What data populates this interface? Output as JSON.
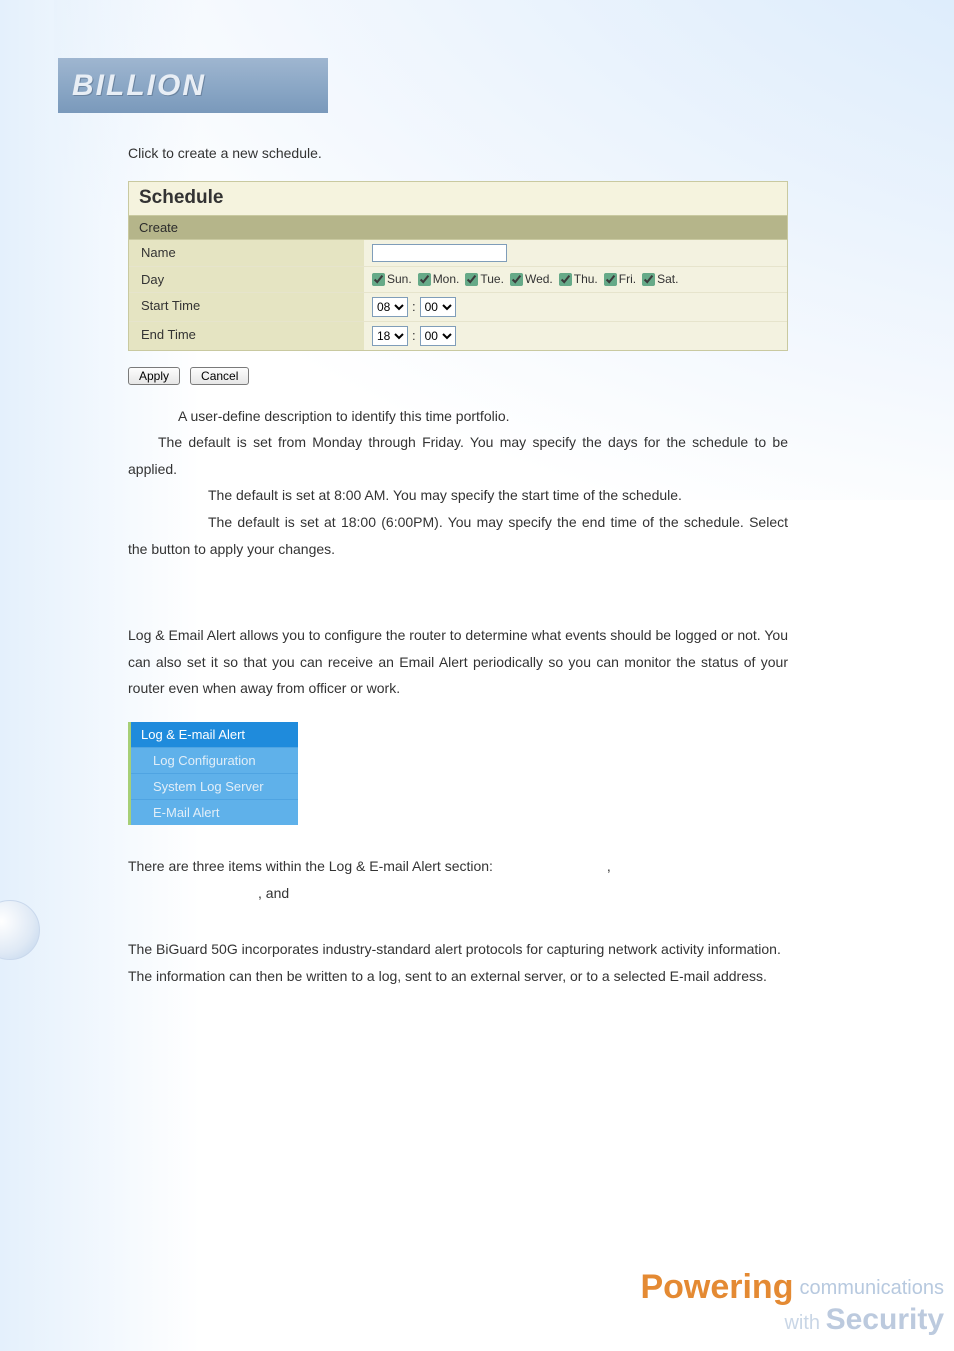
{
  "header": {
    "logo_text": "BILLION"
  },
  "intro": {
    "click_prefix": "Click ",
    "click_suffix": " to create a new schedule."
  },
  "schedule": {
    "title": "Schedule",
    "subtitle": "Create",
    "name_label": "Name",
    "name_value": "",
    "day_label": "Day",
    "days": [
      {
        "label": "Sun.",
        "checked": true
      },
      {
        "label": "Mon.",
        "checked": true
      },
      {
        "label": "Tue.",
        "checked": true
      },
      {
        "label": "Wed.",
        "checked": true
      },
      {
        "label": "Thu.",
        "checked": true
      },
      {
        "label": "Fri.",
        "checked": true
      },
      {
        "label": "Sat.",
        "checked": true
      }
    ],
    "start_label": "Start Time",
    "start_hour": "08",
    "start_min": "00",
    "end_label": "End Time",
    "end_hour": "18",
    "end_min": "00",
    "apply_btn": "Apply",
    "cancel_btn": "Cancel"
  },
  "definitions": {
    "name_text": "A user-define description to identify this time portfolio.",
    "day_text": "The default is set from Monday through Friday.   You may specify the days for the schedule to be applied.",
    "start_text": "The default is set at 8:00 AM.   You may specify the start time of the schedule.",
    "end_pre": "The default is set at 18:00 (6:00PM). You may specify the end time of the schedule. Select the ",
    "end_post": " button to apply your changes."
  },
  "logalert": {
    "paragraph": "Log & Email Alert allows you to configure the router to determine what events should be logged or not. You can also set it so that you can receive an Email Alert periodically so you can monitor the status of your router even when away from officer or work.",
    "menu_header": "Log & E-mail Alert",
    "menu_items": [
      "Log Configuration",
      "System Log Server",
      "E-Mail Alert"
    ],
    "items_pre": "There are three items within the Log & E-mail Alert section: ",
    "items_comma": ",",
    "items_and": ", and ",
    "biguard": "The BiGuard 50G incorporates industry-standard alert protocols for capturing network activity information. The information can then be written to a log, sent to an external server, or to a selected E-mail address."
  },
  "footer": {
    "powering": "Powering",
    "communications": "communications",
    "with": "with ",
    "security": "Security"
  }
}
